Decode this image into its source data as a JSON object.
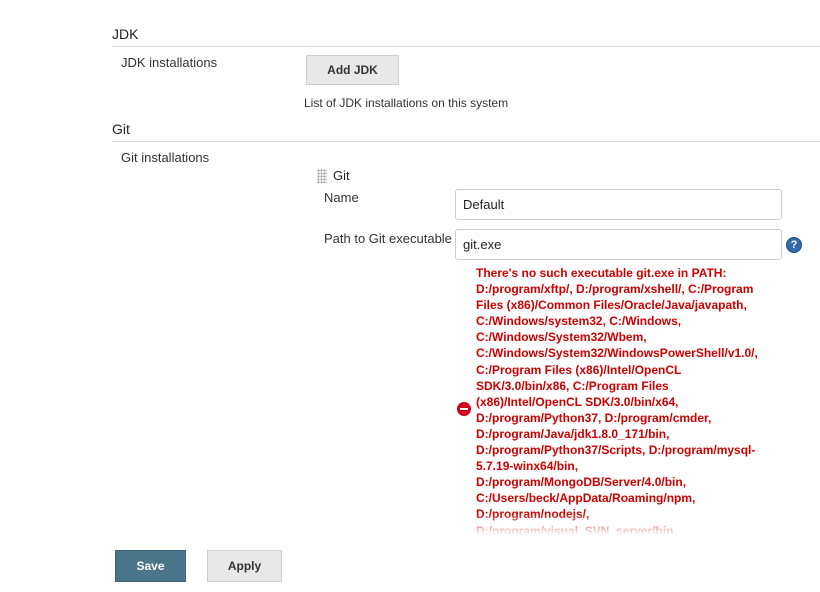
{
  "jdk": {
    "section_title": "JDK",
    "installations_label": "JDK installations",
    "add_button_label": "Add JDK",
    "help_text": "List of JDK installations on this system"
  },
  "git": {
    "section_title": "Git",
    "installations_label": "Git installations",
    "item_title": "Git",
    "name_label": "Name",
    "name_value": "Default",
    "path_label": "Path to Git executable",
    "path_value": "git.exe",
    "help_icon_glyph": "?",
    "error_lines": [
      "There's no such executable git.exe in PATH:",
      "D:/program/xftp/, D:/program/xshell/, C:/Program",
      "Files (x86)/Common Files/Oracle/Java/javapath,",
      "C:/Windows/system32, C:/Windows,",
      "C:/Windows/System32/Wbem,",
      "C:/Windows/System32/WindowsPowerShell/v1.0/,",
      "C:/Program Files (x86)/Intel/OpenCL",
      "SDK/3.0/bin/x86, C:/Program Files",
      "(x86)/Intel/OpenCL SDK/3.0/bin/x64,",
      "D:/program/Python37, D:/program/cmder,",
      "D:/program/Java/jdk1.8.0_171/bin,",
      "D:/program/Python37/Scripts, D:/program/mysql-",
      "5.7.19-winx64/bin,",
      "D:/program/MongoDB/Server/4.0/bin,",
      "C:/Users/beck/AppData/Roaming/npm,",
      "D:/program/nodejs/,",
      "D:/program/visual_SVN_server/bin,"
    ]
  },
  "footer": {
    "save_label": "Save",
    "apply_label": "Apply"
  },
  "colors": {
    "primary_button": "#4b758b",
    "error_text": "#cc0000",
    "help_icon": "#2f6aa9"
  }
}
